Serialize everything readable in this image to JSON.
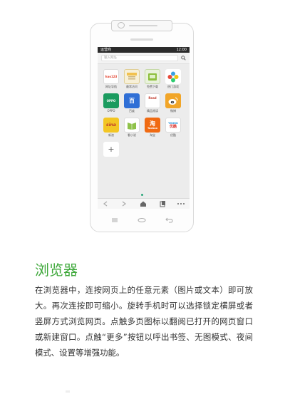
{
  "status_bar": {
    "carrier": "运营商",
    "time": "12:00"
  },
  "browser": {
    "url_placeholder": "输入网址",
    "tiles": [
      {
        "label": "网址导航",
        "icon": "hao123-nav-icon",
        "color": "#ffffff"
      },
      {
        "label": "最常访问",
        "icon": "frequent-visit-icon",
        "color": "#f2c14e"
      },
      {
        "label": "免费下载",
        "icon": "free-download-icon",
        "color": "#8dbf3c"
      },
      {
        "label": "热门游戏",
        "icon": "hot-games-icon",
        "color": "#ffffff"
      },
      {
        "label": "OPPO",
        "icon": "oppo-icon",
        "color": "#1b9b5f"
      },
      {
        "label": "百度",
        "icon": "baidu-icon",
        "color": "#2f6fd6"
      },
      {
        "label": "精品阅读",
        "icon": "reading-icon",
        "color": "#ffffff"
      },
      {
        "label": "微博",
        "icon": "weibo-icon",
        "color": "#f1a528"
      },
      {
        "label": "新浪",
        "icon": "sina-icon",
        "color": "#f3c623"
      },
      {
        "label": "看小说",
        "icon": "novel-icon",
        "color": "#ffffff"
      },
      {
        "label": "淘宝",
        "icon": "taobao-icon",
        "color": "#f06a12"
      },
      {
        "label": "优酷",
        "icon": "youku-icon",
        "color": "#ffffff"
      }
    ],
    "tile_texts": {
      "hao123": "hao123",
      "oppo": "OPPO",
      "baidu": "百",
      "read": "Read",
      "sina": "sina",
      "taobao": "淘",
      "taobao_sub": "Taobao",
      "youku": "YOUKU",
      "youku_sub": "优酷"
    },
    "add_label": "+",
    "toolbar": [
      "back-icon",
      "forward-icon",
      "home-icon",
      "tabs-icon",
      "more-icon"
    ]
  },
  "section": {
    "title": "浏览器",
    "description": "在浏览器中，连按网页上的任意元素（图片或文本）即可放大。再次连按即可缩小。旋转手机时可以选择锁定横屏或者竖屏方式浏览网页。点触多页图标以翻阅已打开的网页窗口或新建窗口。点触“更多”按钮以呼出书签、无图模式、夜间模式、设置等增强功能。"
  },
  "colors": {
    "accent": "#3ea83a",
    "status_bar": "#2b2b2b"
  }
}
